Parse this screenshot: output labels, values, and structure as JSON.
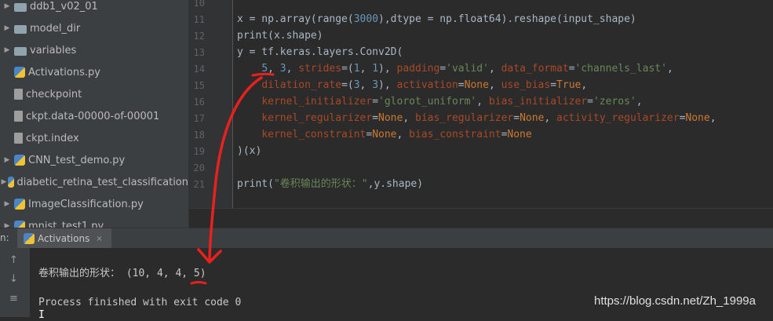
{
  "project_tree": {
    "items": [
      {
        "label": "ddb1_v02_01",
        "type": "folder",
        "expandable": true
      },
      {
        "label": "model_dir",
        "type": "folder",
        "expandable": true
      },
      {
        "label": "variables",
        "type": "folder",
        "expandable": true
      },
      {
        "label": "Activations.py",
        "type": "python",
        "expandable": false
      },
      {
        "label": "checkpoint",
        "type": "file",
        "expandable": false
      },
      {
        "label": "ckpt.data-00000-of-00001",
        "type": "file",
        "expandable": false
      },
      {
        "label": "ckpt.index",
        "type": "file",
        "expandable": false
      },
      {
        "label": "CNN_test_demo.py",
        "type": "python",
        "expandable": true
      },
      {
        "label": "diabetic_retina_test_classification",
        "type": "python",
        "expandable": true
      },
      {
        "label": "ImageClassification.py",
        "type": "python",
        "expandable": true
      },
      {
        "label": "mnist_test1.py",
        "type": "python",
        "expandable": true
      }
    ]
  },
  "editor": {
    "line_numbers": [
      "10",
      "11",
      "12",
      "13",
      "14",
      "15",
      "16",
      "17",
      "18",
      "19",
      "20",
      "21"
    ]
  },
  "run_panel": {
    "label": "n:",
    "tab_label": "Activations",
    "tab_close": "×",
    "output_line": "卷积输出的形状： (10, 4, 4, 5)",
    "finish_line": "Process finished with exit code 0",
    "cursor": "I"
  },
  "icons": {
    "arrow_right": "▶",
    "up": "↑",
    "down": "↓",
    "wrap": "≡"
  },
  "annotation_color": "#e8211e",
  "watermark": "https://blog.csdn.net/Zh_1999a"
}
